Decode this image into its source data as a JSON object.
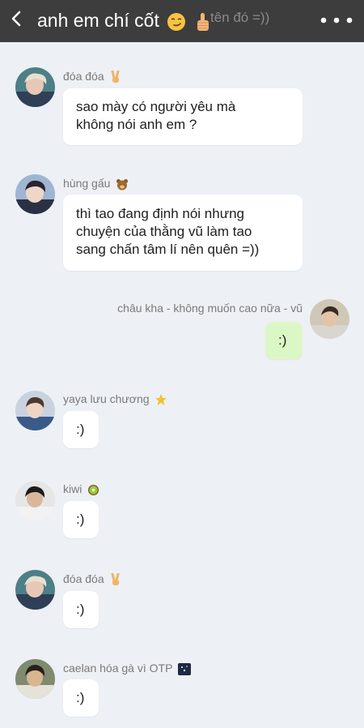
{
  "header": {
    "title": "anh em chí cốt",
    "title_emoji": [
      "smirking-face-emoji",
      "thumbs-up-emoji"
    ],
    "hidden_text": "tên đó =))"
  },
  "messages": [
    {
      "sender": "đóa đóa",
      "text": "sao mày có người yêu mà\nkhông nói anh em ?",
      "emoji": "victory-hand-emoji"
    },
    {
      "sender": "hùng gấu",
      "text": "thì tao đang định nói nhưng\nchuyện của thằng vũ làm tao\nsang chấn tâm lí nên quên =))",
      "emoji": "bear-emoji"
    },
    {
      "sender": "châu kha - không muốn cao nữa -  vũ",
      "text": ":)",
      "mine": true
    },
    {
      "sender": "yaya lưu chương",
      "text": ":)",
      "emoji": "star-emoji"
    },
    {
      "sender": "kiwi",
      "text": ":)",
      "emoji": "kiwi-emoji"
    },
    {
      "sender": "đóa đóa",
      "text": ":)",
      "emoji": "victory-hand-emoji"
    },
    {
      "sender": "caelan hóa gà vì OTP",
      "text": ":)",
      "emoji": "night-sky-emoji"
    }
  ],
  "colors": {
    "header_bg": "#3d3d3d",
    "chat_bg": "#edf0f5",
    "bubble_incoming": "#ffffff",
    "bubble_outgoing": "#dcf7c6",
    "sender_name": "#7a7a7a"
  }
}
